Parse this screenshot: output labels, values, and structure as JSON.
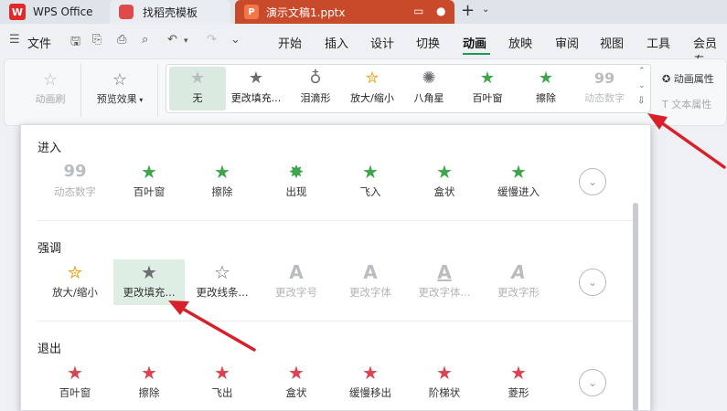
{
  "tabs": {
    "wps": "WPS Office",
    "template": "找稻壳模板",
    "document": "演示文稿1.pptx"
  },
  "menu": {
    "file": "文件",
    "items": [
      "开始",
      "插入",
      "设计",
      "切换",
      "动画",
      "放映",
      "审阅",
      "视图",
      "工具",
      "会员专"
    ]
  },
  "ribbon": {
    "animation_brush": "动画刷",
    "preview_effect": "预览效果",
    "gallery": [
      {
        "label": "无",
        "icon": "star-gray",
        "selected": true
      },
      {
        "label": "更改填充...",
        "icon": "star-dark"
      },
      {
        "label": "泪滴形",
        "icon": "teardrop"
      },
      {
        "label": "放大/缩小",
        "icon": "stars-yellow"
      },
      {
        "label": "八角星",
        "icon": "octagram"
      },
      {
        "label": "百叶窗",
        "icon": "star-green"
      },
      {
        "label": "擦除",
        "icon": "star-green"
      },
      {
        "label": "动态数字",
        "icon": "digits-99",
        "disabled": true
      }
    ],
    "animation_props": "动画属性",
    "text_props": "文本属性"
  },
  "panel": {
    "enter": {
      "title": "进入",
      "items": [
        {
          "label": "动态数字",
          "disabled": true
        },
        {
          "label": "百叶窗"
        },
        {
          "label": "擦除"
        },
        {
          "label": "出现"
        },
        {
          "label": "飞入"
        },
        {
          "label": "盒状"
        },
        {
          "label": "缓慢进入"
        }
      ]
    },
    "emphasis": {
      "title": "强调",
      "items": [
        {
          "label": "放大/缩小"
        },
        {
          "label": "更改填充...",
          "selected": true
        },
        {
          "label": "更改线条..."
        },
        {
          "label": "更改字号",
          "disabled": true
        },
        {
          "label": "更改字体",
          "disabled": true
        },
        {
          "label": "更改字体...",
          "disabled": true
        },
        {
          "label": "更改字形",
          "disabled": true
        }
      ]
    },
    "exit": {
      "title": "退出",
      "items": [
        {
          "label": "百叶窗"
        },
        {
          "label": "擦除"
        },
        {
          "label": "飞出"
        },
        {
          "label": "盒状"
        },
        {
          "label": "缓慢移出"
        },
        {
          "label": "阶梯状"
        },
        {
          "label": "菱形"
        }
      ]
    }
  },
  "colors": {
    "accent_green": "#1e9a56",
    "doc_tab": "#c94a2b",
    "arrow_red": "#d8202a"
  }
}
